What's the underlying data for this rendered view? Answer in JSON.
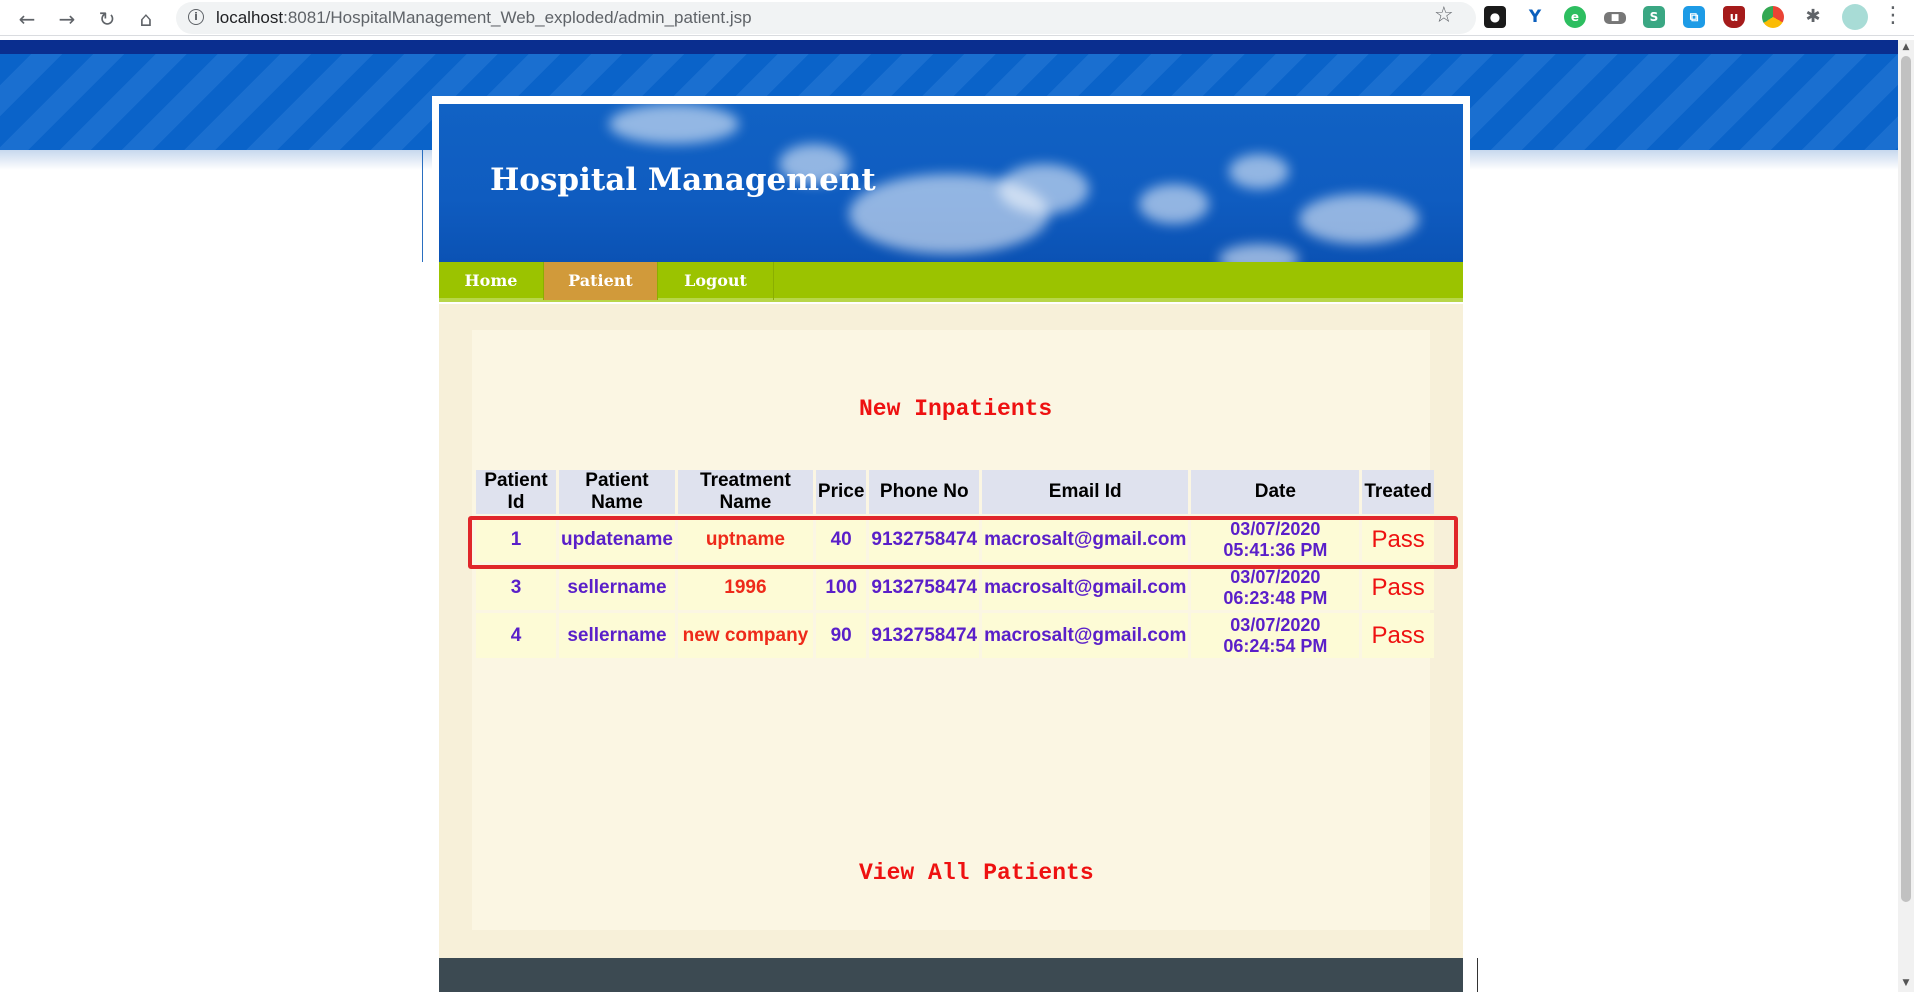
{
  "browser": {
    "url_host": "localhost",
    "url_path": ":8081/HospitalManagement_Web_exploded/admin_patient.jsp",
    "nav_icons": [
      "back-icon",
      "forward-icon",
      "reload-icon",
      "home-icon"
    ],
    "extension_icons": [
      "dark-reader-icon",
      "vimeo-icon",
      "evernote-icon",
      "camera-icon",
      "s-icon",
      "copy-icon",
      "ublock-icon",
      "chrome-icon",
      "puzzle-icon",
      "profile-icon"
    ]
  },
  "site": {
    "title": "Hospital Management",
    "nav": [
      {
        "label": "Home",
        "active": false
      },
      {
        "label": "Patient",
        "active": true
      },
      {
        "label": "Logout",
        "active": false
      }
    ]
  },
  "main": {
    "section_title": "New Inpatients",
    "view_all_label": "View All Patients",
    "table": {
      "headers": [
        "Patient Id",
        "Patient Name",
        "Treatment Name",
        "Price",
        "Phone No",
        "Email Id",
        "Date",
        "Treated"
      ],
      "rows": [
        {
          "id": "1",
          "name": "updatename",
          "treatment": "uptname",
          "price": "40",
          "phone": "9132758474",
          "email": "macrosalt@gmail.com",
          "date": "03/07/2020",
          "time": "05:41:36 PM",
          "treated": "Pass"
        },
        {
          "id": "3",
          "name": "sellername",
          "treatment": "1996",
          "price": "100",
          "phone": "9132758474",
          "email": "macrosalt@gmail.com",
          "date": "03/07/2020",
          "time": "06:23:48 PM",
          "treated": "Pass"
        },
        {
          "id": "4",
          "name": "sellername",
          "treatment": "new company",
          "price": "90",
          "phone": "9132758474",
          "email": "macrosalt@gmail.com",
          "date": "03/07/2020",
          "time": "06:24:54 PM",
          "treated": "Pass"
        }
      ]
    },
    "highlighted_row": 0
  },
  "colors": {
    "accent_red": "#ee1111",
    "nav_green": "#9bc300",
    "nav_active": "#d19a3a",
    "header_blue": "#1162c4",
    "data_purple": "#5a1fc9",
    "highlight_border": "#e0262a"
  }
}
